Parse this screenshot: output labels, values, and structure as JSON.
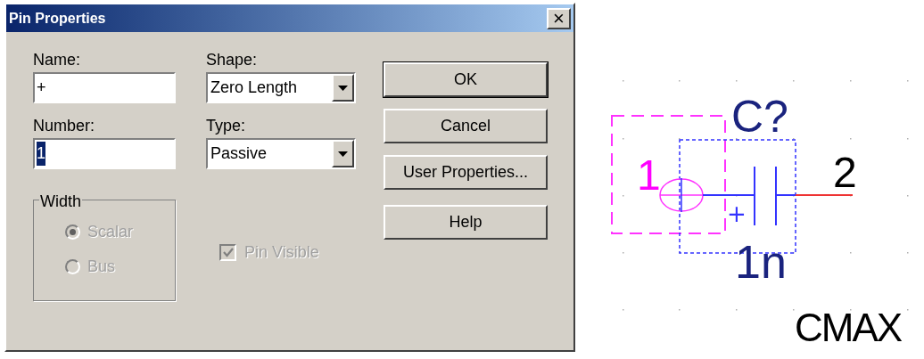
{
  "window": {
    "title": "Pin Properties",
    "close": "×"
  },
  "fields": [
    {
      "label": "Name:",
      "value": "+",
      "selected_text": false
    },
    {
      "label": "Number:",
      "value": "1",
      "selected_text": true
    }
  ],
  "dropdowns": [
    {
      "label": "Shape:",
      "value": "Zero Length"
    },
    {
      "label": "Type:",
      "value": "Passive"
    }
  ],
  "buttons": [
    {
      "label": "OK",
      "default": true
    },
    {
      "label": "Cancel",
      "default": false
    },
    {
      "label": "User Properties...",
      "default": false
    },
    {
      "label": "Help",
      "default": false
    }
  ],
  "width_group": {
    "title": "Width",
    "disabled": true,
    "options": [
      {
        "label": "Scalar",
        "selected": true
      },
      {
        "label": "Bus",
        "selected": false
      }
    ]
  },
  "pin_visible": {
    "label": "Pin Visible",
    "checked": true,
    "disabled": true
  },
  "schematic": {
    "reference": "C?",
    "pin_number": "1",
    "other_pin_number": "2",
    "polarity": "+",
    "value": "1n",
    "part_name": "CMAX"
  }
}
